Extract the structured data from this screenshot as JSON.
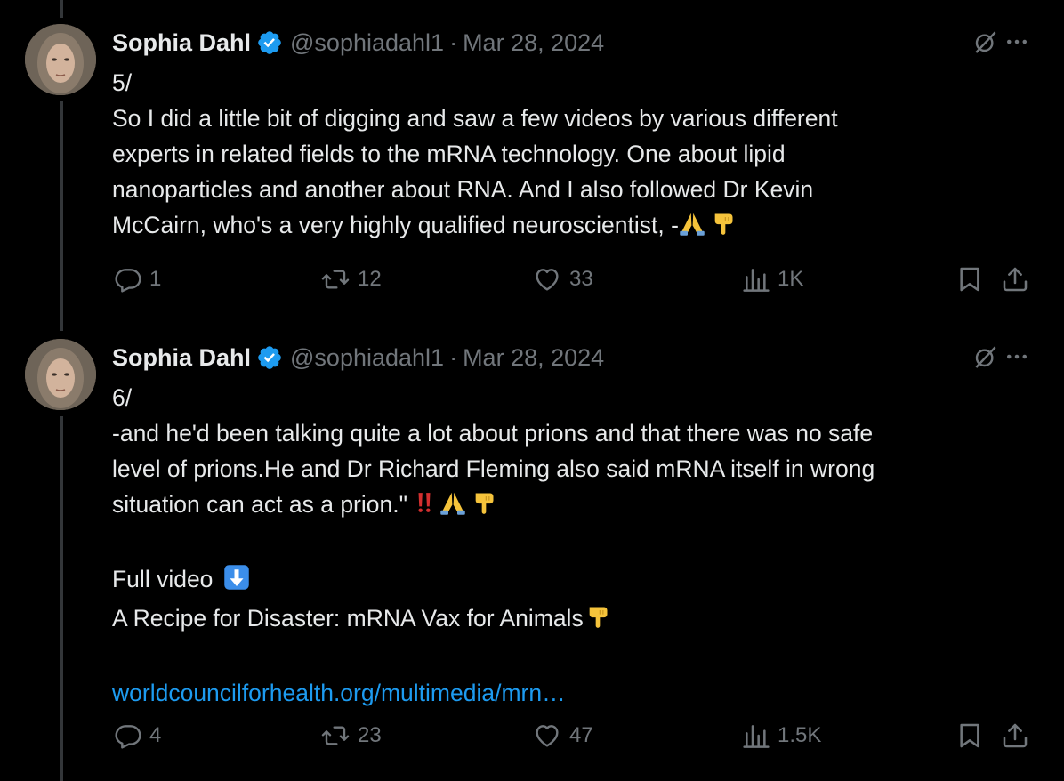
{
  "tweets": [
    {
      "author_name": "Sophia Dahl",
      "handle": "@sophiadahl1",
      "separator": "·",
      "date": "Mar 28, 2024",
      "number": "5/",
      "text_lines": [
        "So I did a little bit of digging and saw a few videos by various different",
        "experts in related fields to the mRNA technology. One about lipid",
        "nanoparticles and another about RNA. And I also followed Dr Kevin",
        "McCairn, who's a very highly qualified neuroscientist, -"
      ],
      "replies": "1",
      "reposts": "12",
      "likes": "33",
      "views": "1K"
    },
    {
      "author_name": "Sophia Dahl",
      "handle": "@sophiadahl1",
      "separator": "·",
      "date": "Mar 28, 2024",
      "number": "6/",
      "text_lines": [
        "-and he'd been talking quite a lot about prions and that there was no safe",
        "level of prions.He and Dr Richard Fleming also said mRNA itself in wrong",
        "situation can act as a prion.\""
      ],
      "full_video_label": "Full video",
      "video_title": "A Recipe for Disaster: mRNA Vax for Animals",
      "link_text": "worldcouncilforhealth.org/multimedia/mrn…",
      "replies": "4",
      "reposts": "23",
      "likes": "47",
      "views": "1.5K"
    }
  ],
  "colors": {
    "background": "#000000",
    "text": "#e7e9ea",
    "muted": "#71767b",
    "link": "#1d9bf0",
    "verified": "#1d9bf0",
    "thread_line": "#333639"
  },
  "icons": [
    "verified-badge-icon",
    "grok-icon",
    "more-icon",
    "reply-icon",
    "repost-icon",
    "like-icon",
    "views-icon",
    "bookmark-icon",
    "share-icon",
    "folded-hands-emoji",
    "pointing-down-emoji",
    "double-exclamation-emoji",
    "down-arrow-emoji"
  ]
}
